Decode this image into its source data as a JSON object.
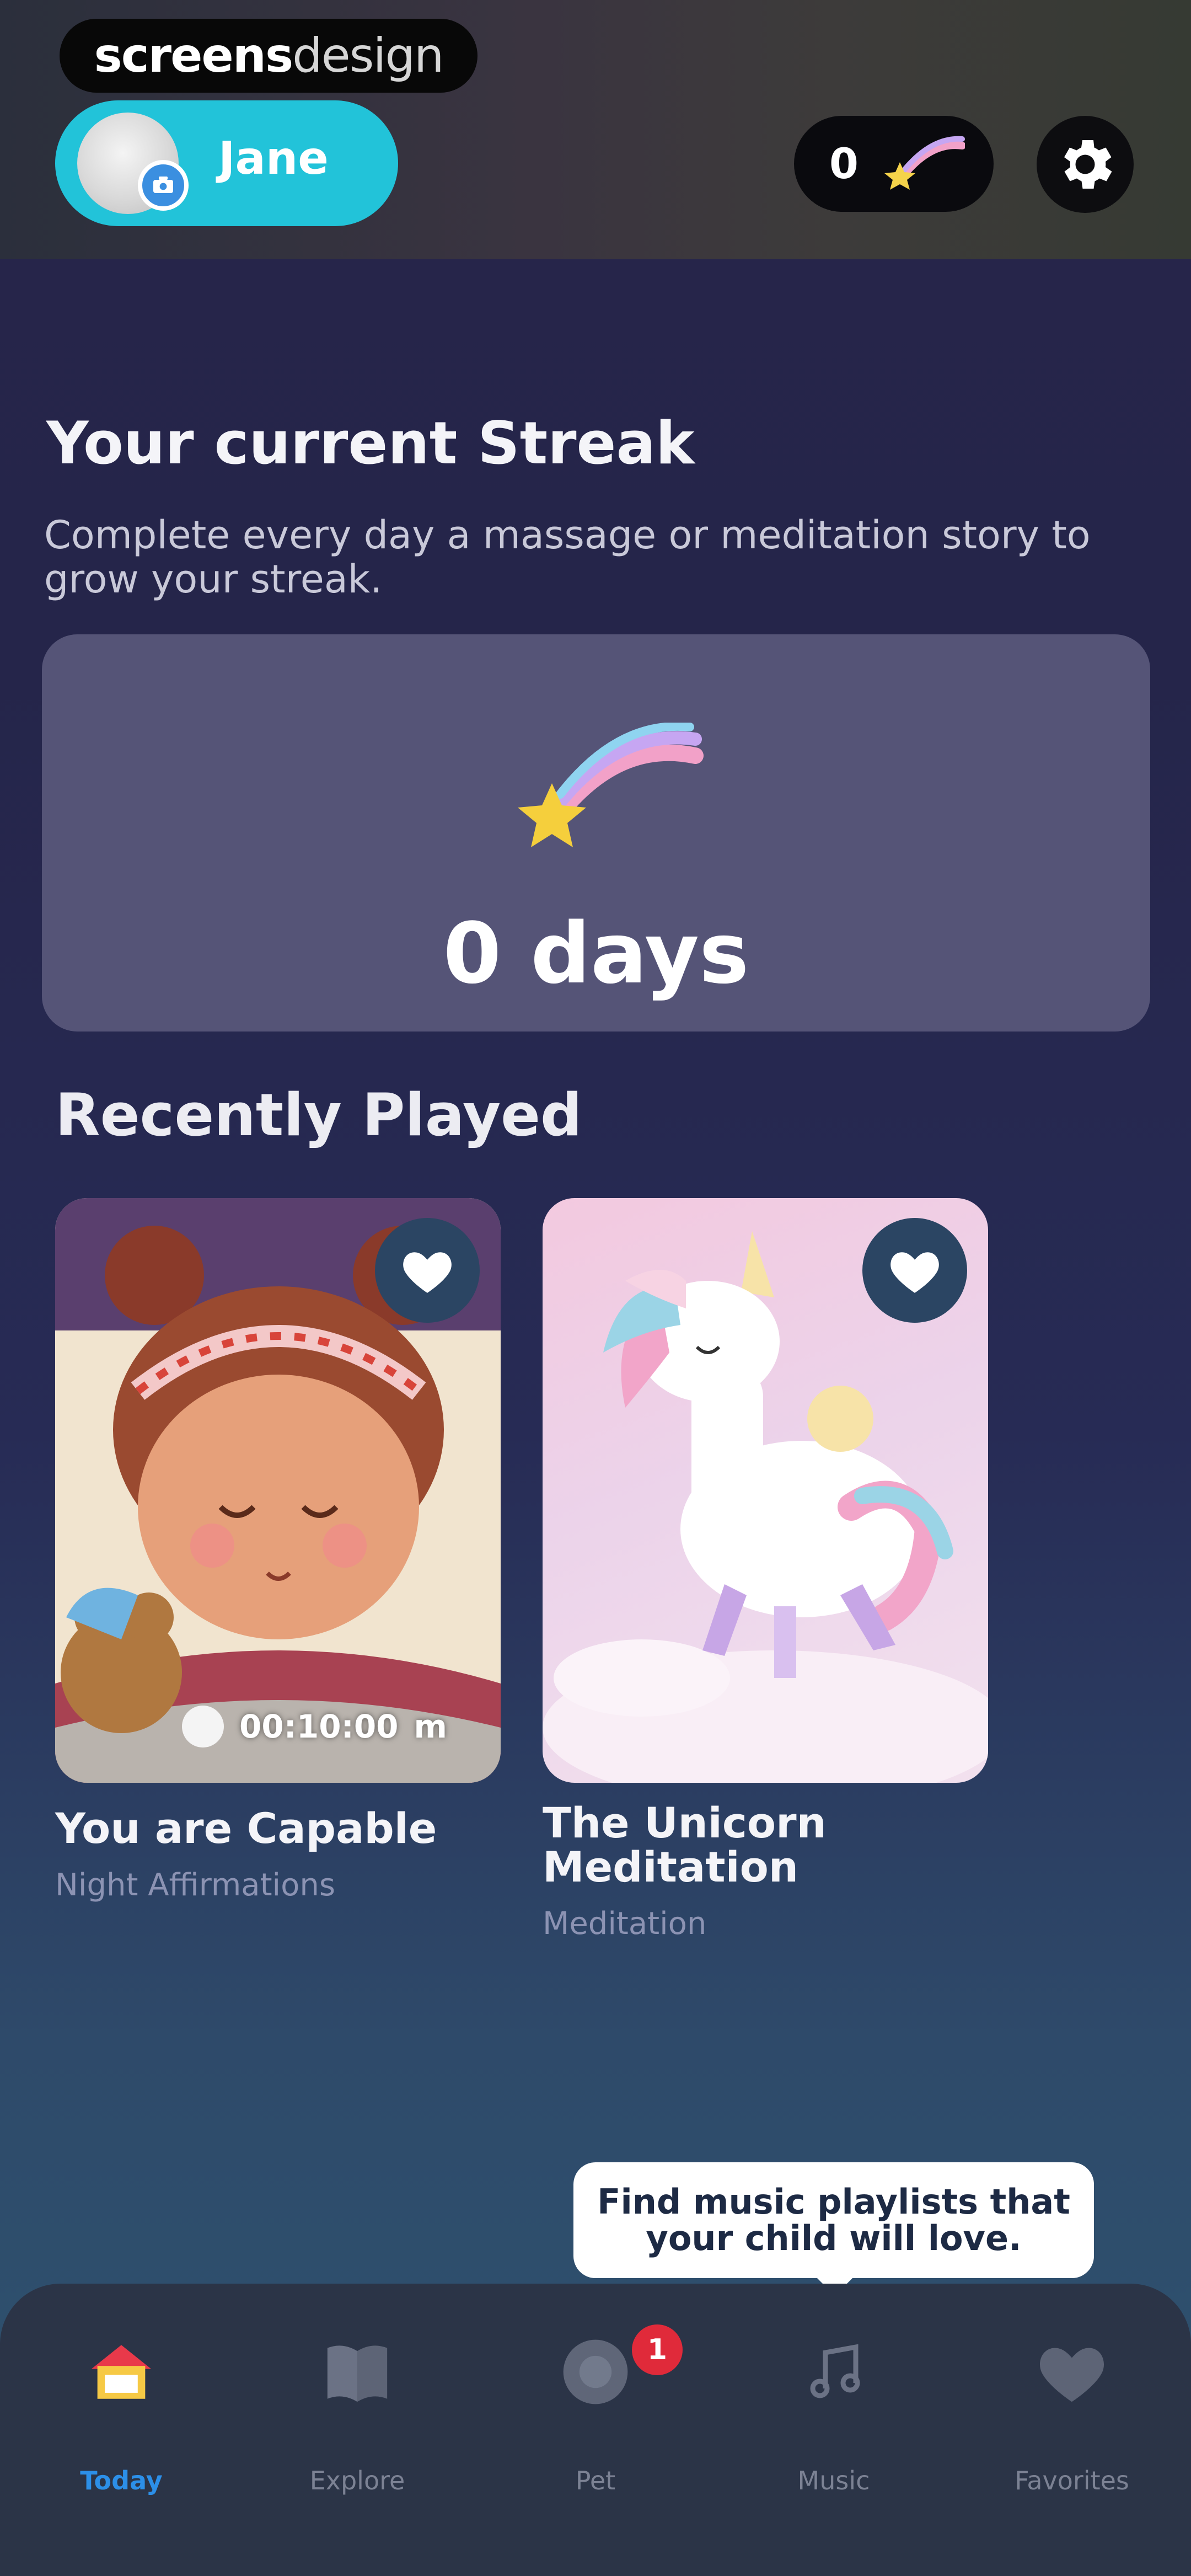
{
  "watermark": {
    "part1": "screens",
    "part2": "design"
  },
  "header": {
    "profile_name": "Jane",
    "stars_count": "0",
    "accent_color": "#22c3d9"
  },
  "streak": {
    "title": "Your current Streak",
    "subtitle": "Complete every day a massage or meditation story to grow your streak.",
    "days_label": "0 days"
  },
  "recent": {
    "title": "Recently Played",
    "items": [
      {
        "title": "You are Capable",
        "subtitle": "Night Affirmations",
        "duration": "00:10:00",
        "duration_unit": "m"
      },
      {
        "title": "The Unicorn Meditation",
        "subtitle": "Meditation"
      }
    ]
  },
  "tooltip": {
    "text": "Find music playlists that your child will love."
  },
  "tabs": [
    {
      "label": "Today",
      "icon": "house-icon",
      "active": true
    },
    {
      "label": "Explore",
      "icon": "book-icon",
      "active": false
    },
    {
      "label": "Pet",
      "icon": "pet-icon",
      "active": false,
      "badge": "1"
    },
    {
      "label": "Music",
      "icon": "music-note-icon",
      "active": false
    },
    {
      "label": "Favorites",
      "icon": "heart-icon",
      "active": false
    }
  ]
}
